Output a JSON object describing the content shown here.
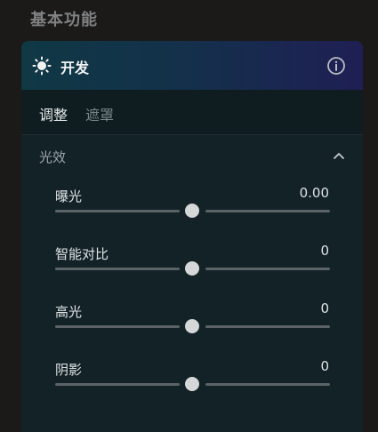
{
  "section_title": "基本功能",
  "panel": {
    "title": "开发",
    "tabs": [
      {
        "label": "调整",
        "active": true
      },
      {
        "label": "遮罩",
        "active": false
      }
    ],
    "group": {
      "title": "光效",
      "expanded": true
    },
    "sliders": [
      {
        "label": "曝光",
        "value": "0.00",
        "position": 0.5
      },
      {
        "label": "智能对比",
        "value": "0",
        "position": 0.5
      },
      {
        "label": "高光",
        "value": "0",
        "position": 0.5
      },
      {
        "label": "阴影",
        "value": "0",
        "position": 0.5
      }
    ]
  },
  "icons": {
    "header": "sun-icon",
    "info": "info-icon",
    "collapse": "chevron-up-icon"
  },
  "colors": {
    "header_gradient_start": "#103845",
    "header_gradient_end": "#1f1f55",
    "panel_bg": "#132227",
    "thumb": "#d6d7d8"
  }
}
